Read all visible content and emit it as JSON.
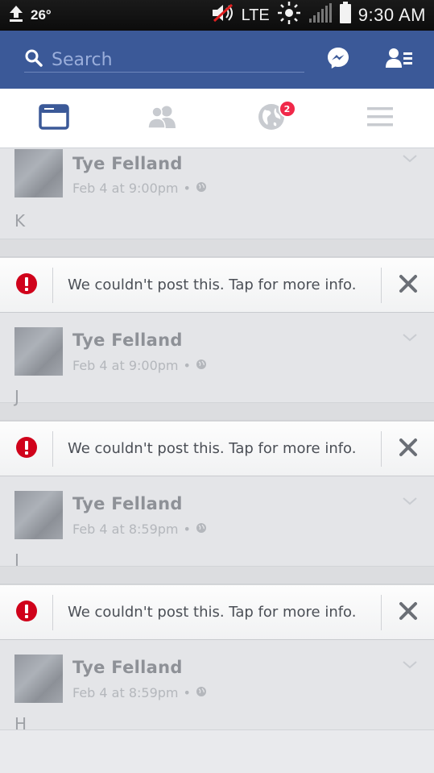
{
  "status_bar": {
    "temperature": "26°",
    "network": "LTE",
    "time": "9:30 AM"
  },
  "header": {
    "search_placeholder": "Search"
  },
  "tabs": {
    "notifications_badge": "2"
  },
  "feed": {
    "posts": [
      {
        "author": "Tye Felland",
        "timestamp": "Feb 4 at 9:00pm",
        "body": "K"
      },
      {
        "author": "Tye Felland",
        "timestamp": "Feb 4 at 9:00pm",
        "body": "J"
      },
      {
        "author": "Tye Felland",
        "timestamp": "Feb 4 at 8:59pm",
        "body": "I"
      },
      {
        "author": "Tye Felland",
        "timestamp": "Feb 4 at 8:59pm",
        "body": "H"
      }
    ],
    "error_message": "We couldn't post this. Tap for more info.",
    "meta_separator": "•"
  },
  "colors": {
    "brand_blue": "#3b5998",
    "error_red": "#d0021b",
    "badge_red": "#f02849"
  }
}
